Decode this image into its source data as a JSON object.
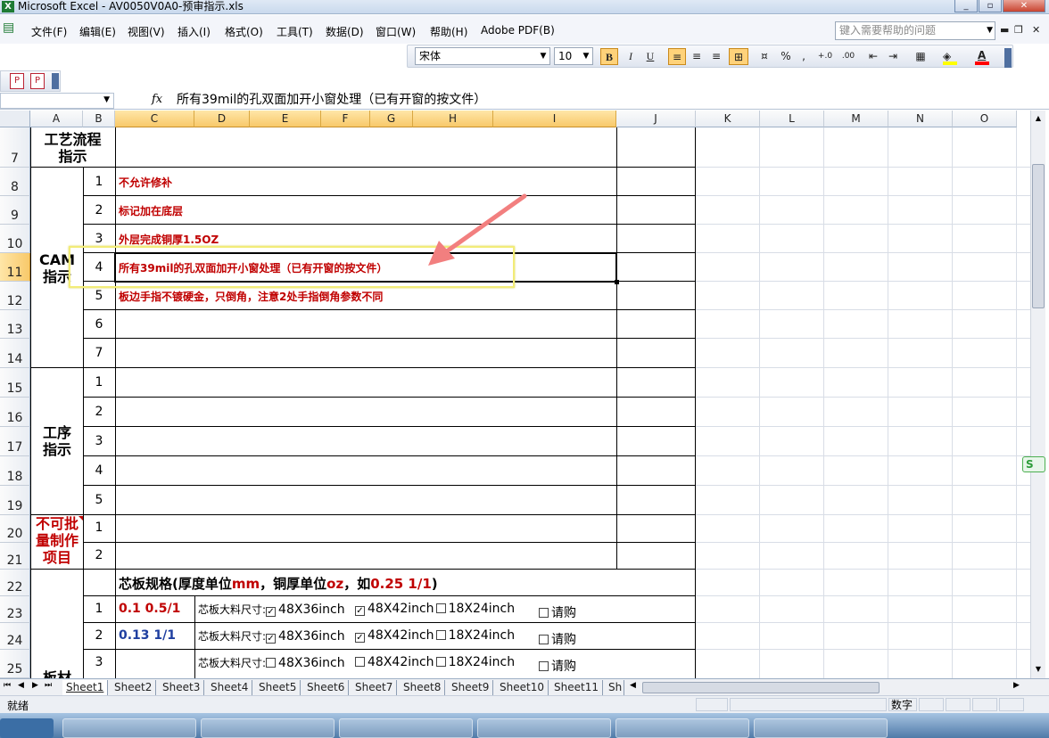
{
  "window": {
    "title": "Microsoft Excel - AV0050V0A0-预审指示.xls",
    "minimize": "_",
    "restore": "▫",
    "close": "✕"
  },
  "menu": {
    "items": [
      "文件(F)",
      "编辑(E)",
      "视图(V)",
      "插入(I)",
      "格式(O)",
      "工具(T)",
      "数据(D)",
      "窗口(W)",
      "帮助(H)",
      "Adobe PDF(B)"
    ],
    "help_placeholder": "键入需要帮助的问题"
  },
  "toolbar": {
    "font_name": "宋体",
    "font_size": "10",
    "bold": "B",
    "italic": "I",
    "underline": "U",
    "percent": "%",
    "comma": ",",
    "inc_decimal": "+.0",
    "dec_decimal": ".00",
    "fill_color": "#ffff00",
    "font_color": "#ff0000"
  },
  "formula": {
    "fx": "fx",
    "content": "所有39mil的孔双面加开小窗处理（已有开窗的按文件）"
  },
  "columns": [
    "A",
    "B",
    "C",
    "D",
    "E",
    "F",
    "G",
    "H",
    "I",
    "J",
    "K",
    "L",
    "M",
    "N",
    "O"
  ],
  "selected_column": "C",
  "rows": [
    "7",
    "8",
    "9",
    "10",
    "11",
    "12",
    "13",
    "14",
    "15",
    "16",
    "17",
    "18",
    "19",
    "20",
    "21",
    "22",
    "23",
    "24",
    "25"
  ],
  "selected_row": "11",
  "sheet": {
    "process_label_line1": "工艺流程",
    "process_label_line2": "指示",
    "cam_label_line1": "CAM",
    "cam_label_line2": "指示",
    "cam_items": [
      {
        "n": "1",
        "text": "不允许修补"
      },
      {
        "n": "2",
        "text": "标记加在底层"
      },
      {
        "n": "3",
        "text": "外层完成铜厚1.5OZ"
      },
      {
        "n": "4",
        "text": "所有39mil的孔双面加开小窗处理（已有开窗的按文件）"
      },
      {
        "n": "5",
        "text": "板边手指不镀硬金，只倒角，注意2处手指倒角参数不同"
      },
      {
        "n": "6",
        "text": ""
      },
      {
        "n": "7",
        "text": ""
      }
    ],
    "process_step_line1": "工序",
    "process_step_line2": "指示",
    "process_numbers": [
      "1",
      "2",
      "3",
      "4",
      "5"
    ],
    "nobatch_line1": "不可批",
    "nobatch_line2": "量制作",
    "nobatch_line3": "项目",
    "nobatch_numbers": [
      "1",
      "2"
    ],
    "core_heading_a": "芯板规格(厚度单位",
    "core_heading_b": "mm",
    "core_heading_c": "，铜厚单位",
    "core_heading_d": "oz",
    "core_heading_e": "，如",
    "core_heading_f": "0.25 1/1",
    "core_heading_g": ")",
    "material_label": "板材",
    "core_rows": [
      {
        "n": "1",
        "spec": "0.1 0.5/1",
        "label": "芯板大料尺寸:",
        "opt1": "48X36inch",
        "opt2": "48X42inch",
        "opt3": "18X24inch",
        "opt4": "请购",
        "c1": "✓",
        "c2": "✓",
        "c3": "",
        "c4": ""
      },
      {
        "n": "2",
        "spec": "0.13 1/1",
        "label": "芯板大料尺寸:",
        "opt1": "48X36inch",
        "opt2": "48X42inch",
        "opt3": "18X24inch",
        "opt4": "请购",
        "c1": "✓",
        "c2": "✓",
        "c3": "",
        "c4": ""
      },
      {
        "n": "3",
        "spec": "",
        "label": "芯板大料尺寸:",
        "opt1": "48X36inch",
        "opt2": "48X42inch",
        "opt3": "18X24inch",
        "opt4": "请购",
        "c1": "",
        "c2": "",
        "c3": "",
        "c4": ""
      }
    ]
  },
  "tabs": [
    "Sheet1",
    "Sheet2",
    "Sheet3",
    "Sheet4",
    "Sheet5",
    "Sheet6",
    "Sheet7",
    "Sheet8",
    "Sheet9",
    "Sheet10",
    "Sheet11",
    "Sh"
  ],
  "active_tab": "Sheet1",
  "status": {
    "ready": "就绪",
    "mode": "数字"
  }
}
